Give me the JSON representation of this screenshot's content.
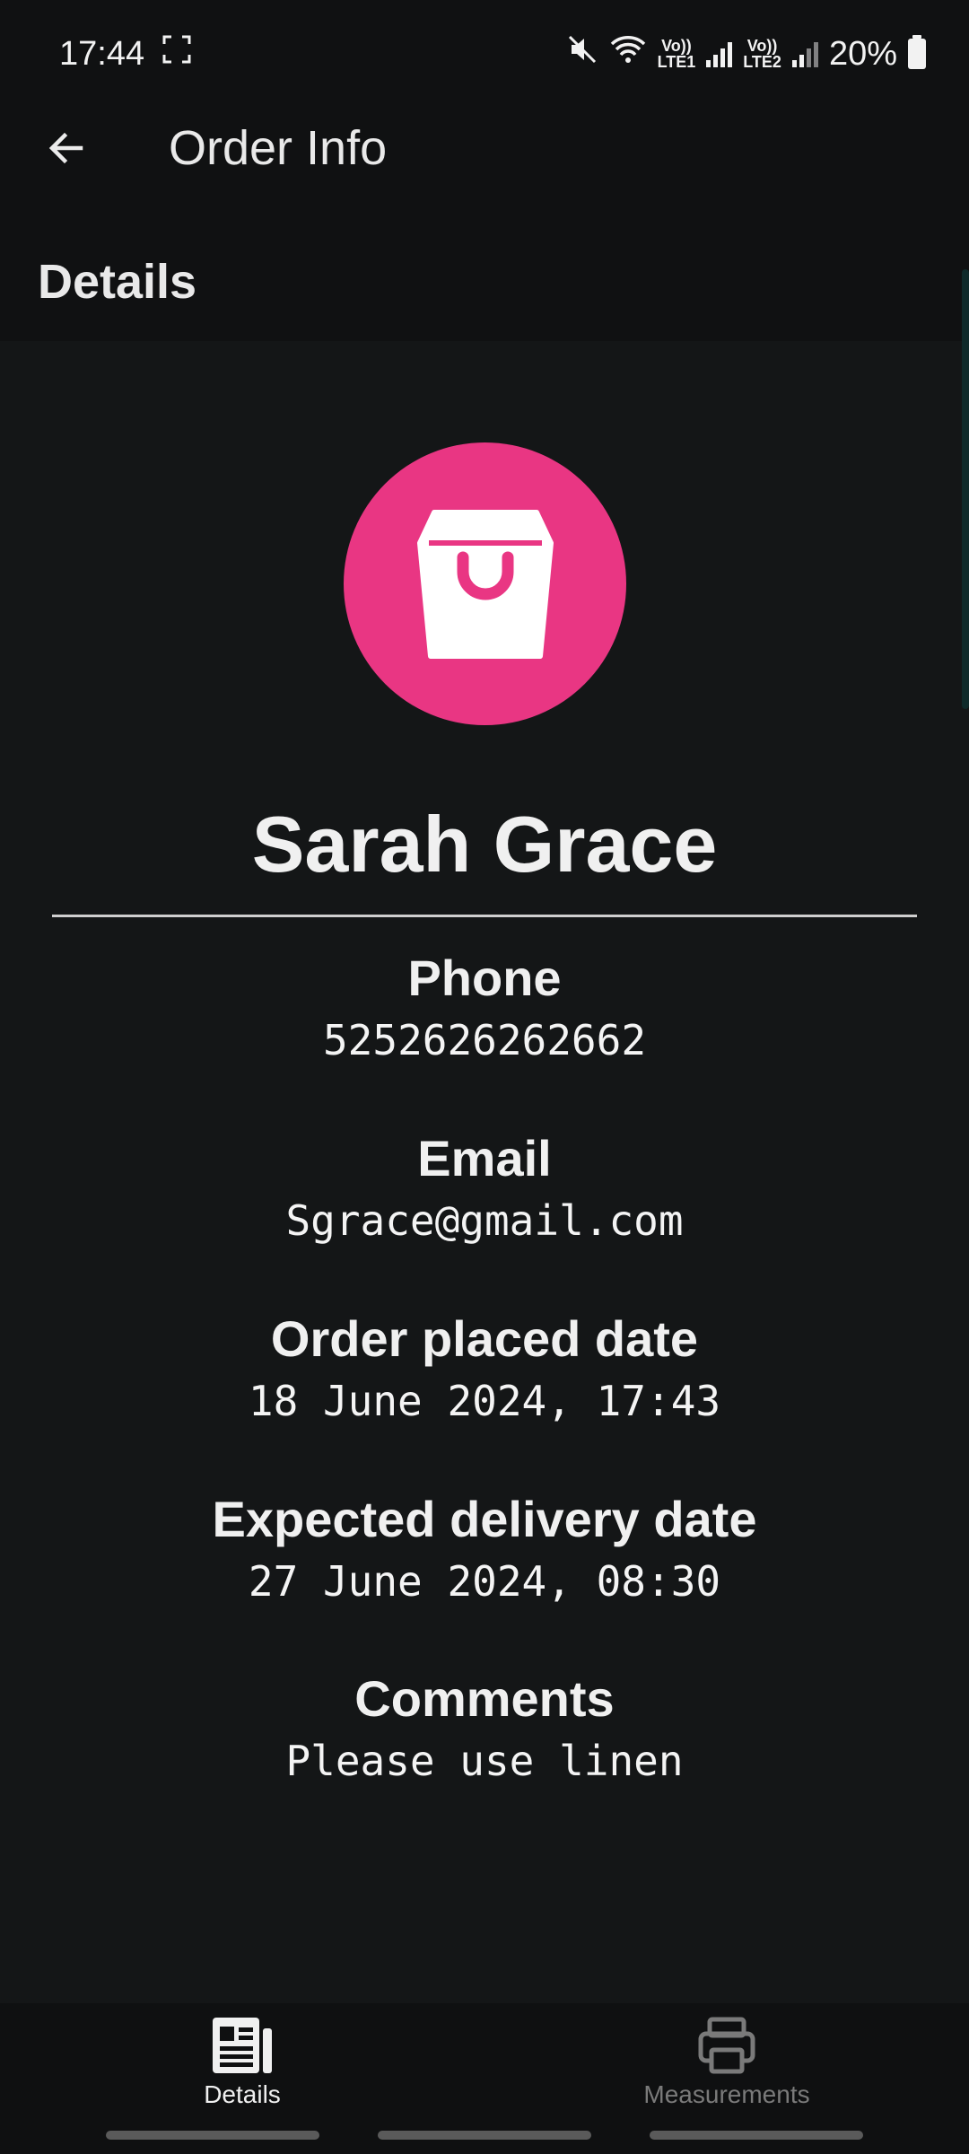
{
  "status_bar": {
    "time": "17:44",
    "sim1": "LTE1",
    "sim2": "LTE2",
    "volte": "Vo))",
    "battery": "20%",
    "icons": [
      "screenshot-icon",
      "mute-icon",
      "wifi-icon",
      "signal-icon",
      "battery-icon"
    ]
  },
  "app_bar": {
    "title": "Order Info",
    "back_icon": "arrow-left-icon"
  },
  "section": {
    "title": "Details"
  },
  "customer": {
    "name": "Sarah Grace",
    "avatar_icon": "shopping-bag-icon",
    "avatar_color": "#e93683"
  },
  "fields": [
    {
      "label": "Phone",
      "value": "5252626262662"
    },
    {
      "label": "Email",
      "value": "Sgrace@gmail.com"
    },
    {
      "label": "Order placed date",
      "value": "18 June 2024, 17:43"
    },
    {
      "label": "Expected delivery date",
      "value": "27 June 2024, 08:30"
    },
    {
      "label": "Comments",
      "value": "Please use linen"
    }
  ],
  "bottom_nav": {
    "items": [
      {
        "label": "Details",
        "icon": "newspaper-icon",
        "active": true
      },
      {
        "label": "Measurements",
        "icon": "printer-icon",
        "active": false
      }
    ]
  }
}
